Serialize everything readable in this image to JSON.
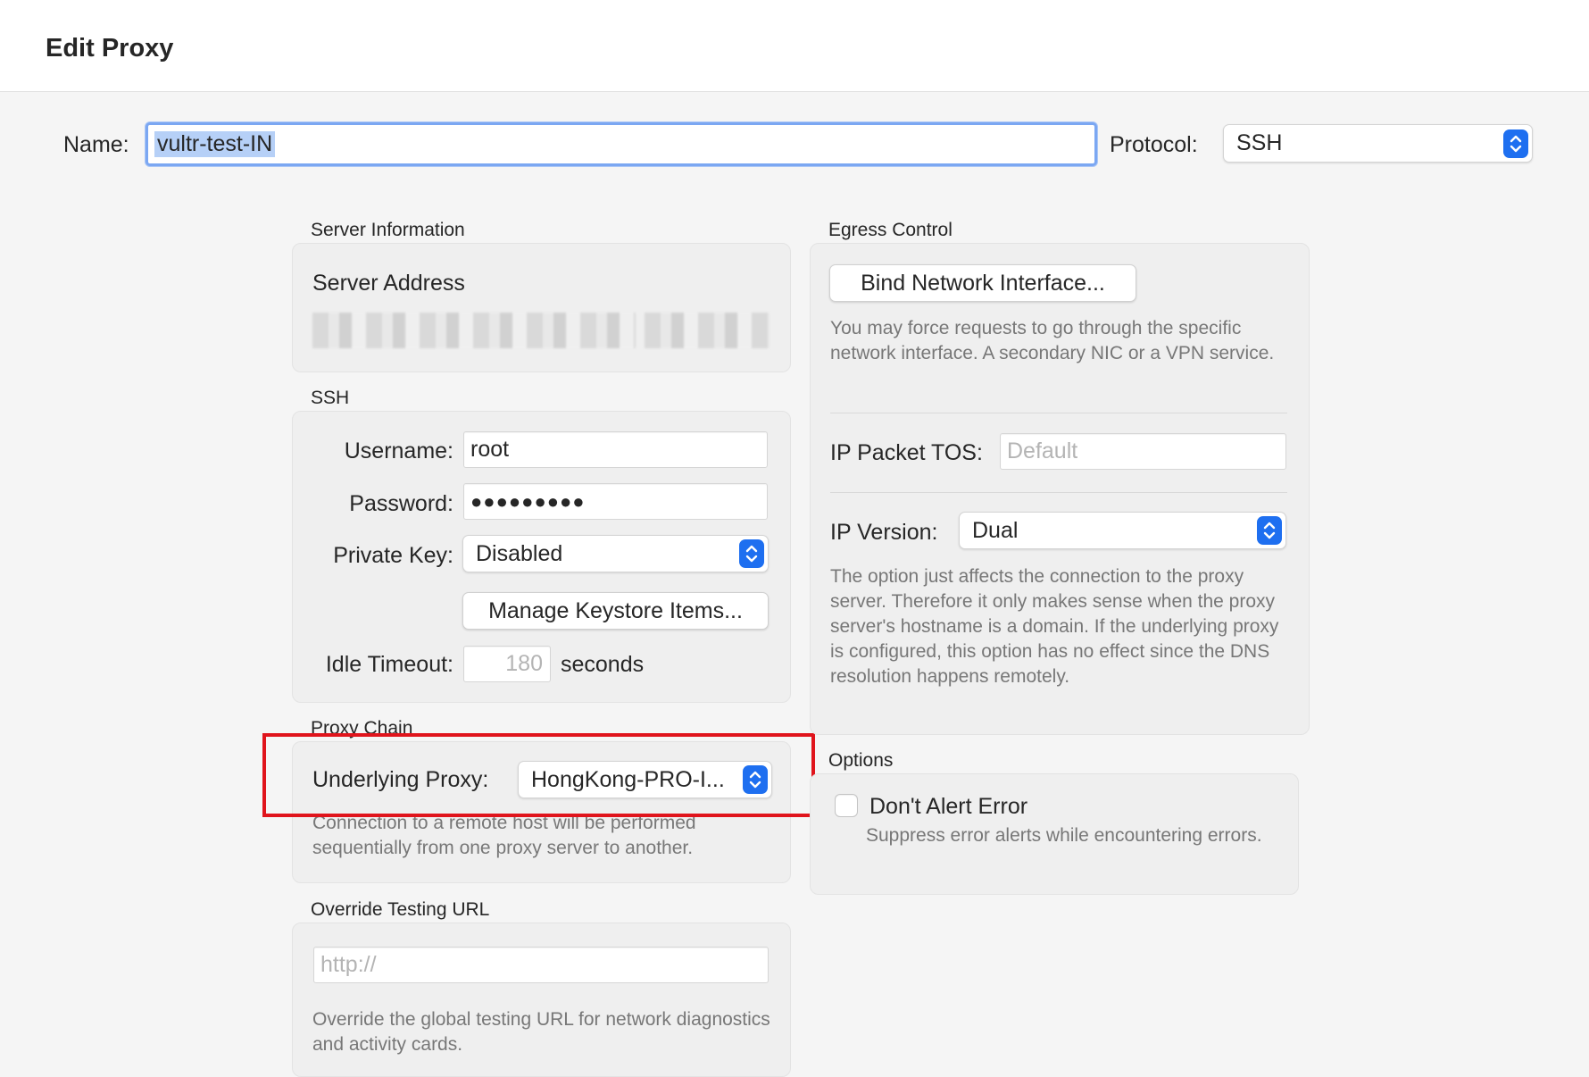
{
  "window": {
    "title": "Edit Proxy"
  },
  "top": {
    "name_label": "Name:",
    "name_value": "vultr-test-IN",
    "protocol_label": "Protocol:",
    "protocol_value": "SSH"
  },
  "server_info": {
    "section": "Server Information",
    "address_label": "Server Address"
  },
  "ssh": {
    "section": "SSH",
    "username_label": "Username:",
    "username_value": "root",
    "password_label": "Password:",
    "password_value": "●●●●●●●●●",
    "private_key_label": "Private Key:",
    "private_key_value": "Disabled",
    "manage_keystore_label": "Manage Keystore Items...",
    "idle_timeout_label": "Idle Timeout:",
    "idle_timeout_value": "180",
    "idle_timeout_unit": "seconds"
  },
  "proxy_chain": {
    "section": "Proxy Chain",
    "underlying_label": "Underlying Proxy:",
    "underlying_value": "HongKong-PRO-I...",
    "help": "Connection to a remote host will be performed sequentially from one proxy server to another."
  },
  "override": {
    "section": "Override Testing URL",
    "placeholder": "http://",
    "help": "Override the global testing URL for network diagnostics and activity cards."
  },
  "egress": {
    "section": "Egress Control",
    "bind_button": "Bind Network Interface...",
    "bind_help": "You may force requests to go through the specific network interface. A secondary NIC or a VPN service.",
    "tos_label": "IP Packet TOS:",
    "tos_placeholder": "Default",
    "ip_version_label": "IP Version:",
    "ip_version_value": "Dual",
    "ip_version_help": "The option just affects the connection to the proxy server. Therefore it only makes sense when the proxy server's hostname is a domain. If the underlying proxy is configured, this option has no effect since the DNS resolution happens remotely."
  },
  "options": {
    "section": "Options",
    "dont_alert_label": "Don't Alert Error",
    "dont_alert_checked": false,
    "dont_alert_help": "Suppress error alerts while encountering errors."
  },
  "colors": {
    "accent": "#1e6ff0",
    "highlight": "#e0141c",
    "focus_ring": "#7ba7f2"
  }
}
